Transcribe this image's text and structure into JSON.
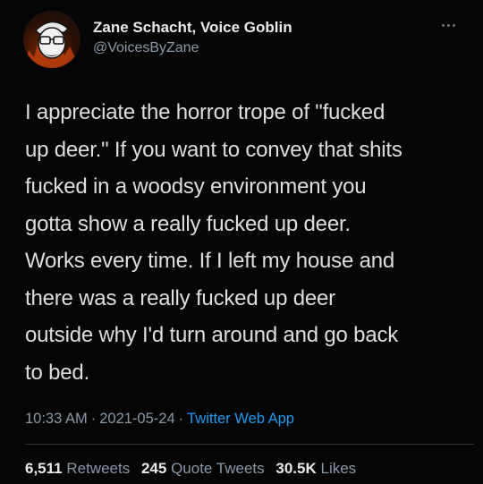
{
  "tweet": {
    "author": {
      "display_name": "Zane Schacht, Voice Goblin",
      "handle": "@VoicesByZane",
      "avatar_icon": "cartoon-avatar-icon"
    },
    "more_icon": "more-dots-icon",
    "body_lines": [
      "I appreciate the horror trope of \"fucked",
      "up deer.\" If you want to convey that shits",
      "fucked in a woodsy environment you",
      "gotta show a really fucked up deer.",
      "Works every time. If I left my house and",
      "there was a really fucked up deer",
      "outside why I'd turn around and go back",
      "to bed."
    ],
    "time": "10:33 AM",
    "date": "2021-05-24",
    "separator": "·",
    "source": "Twitter Web App",
    "stats": {
      "retweets_count": "6,511",
      "retweets_label": "Retweets",
      "quotes_count": "245",
      "quotes_label": "Quote Tweets",
      "likes_count": "30.5K",
      "likes_label": "Likes"
    }
  },
  "colors": {
    "background": "#050505",
    "text": "#dedede",
    "muted": "#8b98a5",
    "link": "#1d9bf0"
  }
}
